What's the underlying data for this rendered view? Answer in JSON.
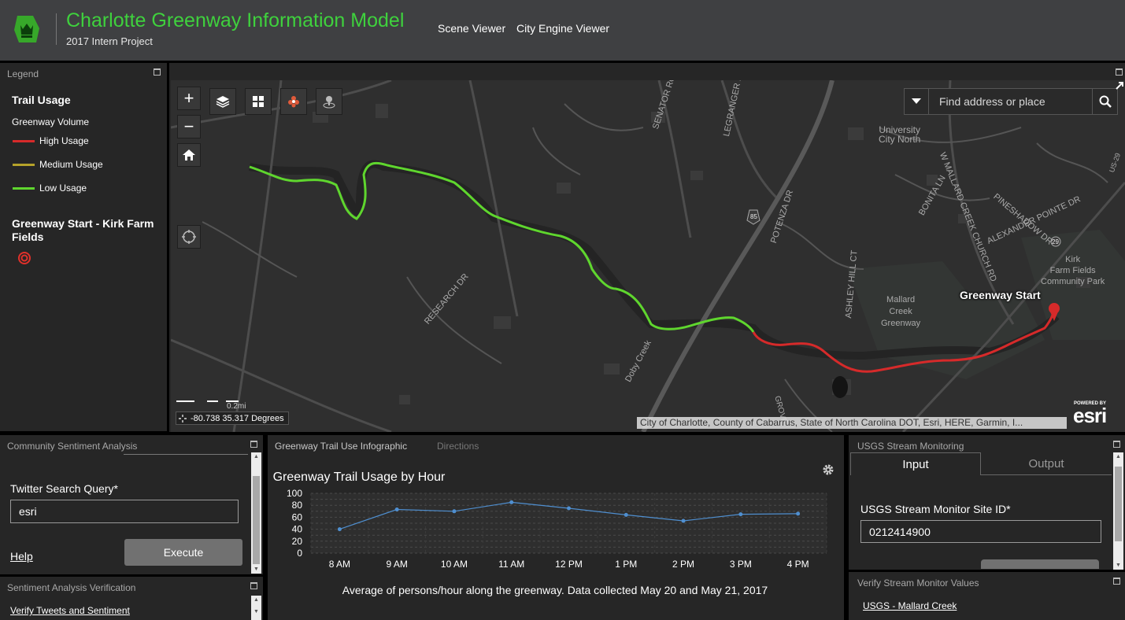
{
  "header": {
    "title": "Charlotte Greenway Information Model",
    "subtitle": "2017 Intern Project",
    "nav": [
      "Scene Viewer",
      "City Engine Viewer"
    ]
  },
  "legend": {
    "title": "Legend",
    "layer1_title": "Trail Usage",
    "layer1_field": "Greenway Volume",
    "items": [
      {
        "label": "High Usage",
        "color": "#d62a2a"
      },
      {
        "label": "Medium Usage",
        "color": "#b5a22a"
      },
      {
        "label": "Low Usage",
        "color": "#5fd62e"
      }
    ],
    "layer2_title": "Greenway Start - Kirk Farm Fields",
    "layer2_symbol_color": "#e0302a"
  },
  "map": {
    "search_placeholder": "Find address or place",
    "coordinates": "-80.738 35.317 Degrees",
    "scale": "0.2mi",
    "attribution": "City of Charlotte, County of Cabarrus, State of North Carolina DOT, Esri, HERE, Garmin, I...",
    "powered_by": "POWERED BY",
    "esri": "esri",
    "greenway_start_label": "Greenway Start",
    "labels": {
      "university": "University",
      "city_north": "City North",
      "mallard": "Mallard",
      "creek": "Creek",
      "greenway": "Greenway",
      "kirk": "Kirk",
      "farm_fields": "Farm Fields",
      "community_park": "Community Park",
      "senator_royall": "SENATOR ROYALL PL",
      "legranger": "LEGRANGER RD",
      "research": "RESEARCH DR",
      "doby_creek": "Doby Creek",
      "potenza": "POTENZA DR",
      "ashley_hill": "ASHLEY HILL CT",
      "bonita": "BONITA LN",
      "pineshadow": "PINESHADOW DR",
      "alexander": "ALEXANDER POINTE DR",
      "mallard_creek_church": "W MALLARD CREEK CHURCH RD",
      "i85": "85",
      "us29": "US-29",
      "r29": "29",
      "grove": "GROVE"
    },
    "colors": {
      "high": "#d62a2a",
      "low": "#5fd62e"
    }
  },
  "sentiment": {
    "title": "Community Sentiment Analysis",
    "query_label": "Twitter Search Query*",
    "query_value": "esri",
    "help": "Help",
    "execute": "Execute"
  },
  "verification": {
    "title": "Sentiment Analysis Verification",
    "link": "Verify Tweets and Sentiment"
  },
  "infographic": {
    "tabs": [
      "Greenway Trail Use Infographic",
      "Directions"
    ],
    "caption": "Average of persons/hour along the greenway.  Data collected May 20 and May 21, 2017"
  },
  "chart_data": {
    "type": "line",
    "title": "Greenway Trail Usage by Hour",
    "categories": [
      "8 AM",
      "9 AM",
      "10 AM",
      "11 AM",
      "12 PM",
      "1 PM",
      "2 PM",
      "3 PM",
      "4 PM"
    ],
    "values": [
      40,
      73,
      70,
      85,
      75,
      64,
      54,
      65,
      66
    ],
    "ylim": [
      0,
      100
    ],
    "yticks": [
      0,
      10,
      20,
      30,
      40,
      50,
      60,
      70,
      80,
      90,
      100
    ],
    "ytick_labels": [
      "0",
      "20",
      "40",
      "60",
      "80",
      "100"
    ],
    "line_color": "#4f8fd0",
    "grid": true
  },
  "usgs": {
    "title": "USGS Stream Monitoring",
    "tabs": [
      "Input",
      "Output"
    ],
    "site_label": "USGS Stream Monitor Site ID*",
    "site_value": "0212414900"
  },
  "verify_stream": {
    "title": "Verify Stream Monitor Values",
    "link": "USGS - Mallard Creek"
  }
}
